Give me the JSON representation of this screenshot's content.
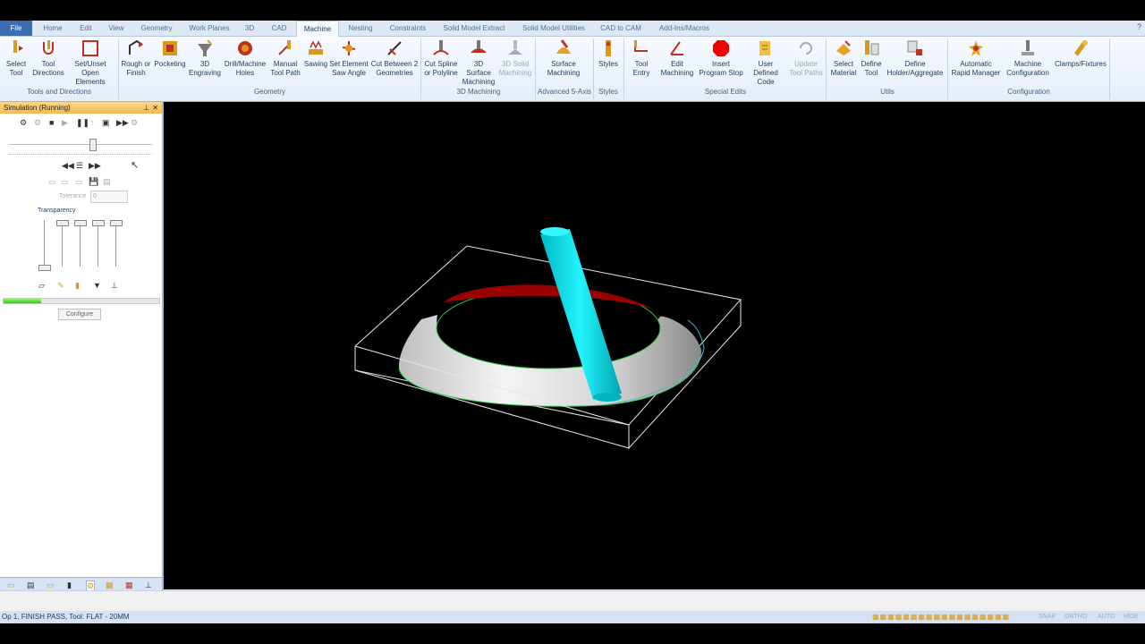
{
  "tabs": [
    {
      "label": "File"
    },
    {
      "label": "Home"
    },
    {
      "label": "Edit"
    },
    {
      "label": "View"
    },
    {
      "label": "Geometry"
    },
    {
      "label": "Work Planes"
    },
    {
      "label": "3D"
    },
    {
      "label": "CAD"
    },
    {
      "label": "Machine"
    },
    {
      "label": "Nesting"
    },
    {
      "label": "Constraints"
    },
    {
      "label": "Solid Model Extract"
    },
    {
      "label": "Solid Model Utilities"
    },
    {
      "label": "CAD to CAM"
    },
    {
      "label": "Add-Ins/Macros"
    }
  ],
  "window_controls": "– ▭ ✕",
  "ribbon": {
    "buttons": [
      {
        "label": "Select Tool",
        "icon": "select-tool-icon"
      },
      {
        "label": "Tool Directions",
        "icon": "tool-directions-icon"
      },
      {
        "label": "Set/Unset Open Elements",
        "icon": "open-elements-icon"
      },
      {
        "label": "Rough or Finish",
        "icon": "rough-finish-icon"
      },
      {
        "label": "Pocketing",
        "icon": "pocketing-icon"
      },
      {
        "label": "3D Engraving",
        "icon": "engraving-icon"
      },
      {
        "label": "Drill/Machine Holes",
        "icon": "drill-icon"
      },
      {
        "label": "Manual Tool Path",
        "icon": "manual-path-icon"
      },
      {
        "label": "Sawing",
        "icon": "sawing-icon"
      },
      {
        "label": "Set Element Saw Angle",
        "icon": "saw-angle-icon"
      },
      {
        "label": "Cut Between 2 Geometries",
        "icon": "cut-between-icon"
      },
      {
        "label": "Cut Spline or Polyline",
        "icon": "cut-spline-icon"
      },
      {
        "label": "3D Surface Machining",
        "icon": "surface-machining-icon"
      },
      {
        "label": "3D Solid Machining",
        "icon": "solid-machining-icon"
      },
      {
        "label": "Surface Machining",
        "icon": "surface-5axis-icon"
      },
      {
        "label": "Styles",
        "icon": "styles-icon"
      },
      {
        "label": "Tool Entry",
        "icon": "tool-entry-icon"
      },
      {
        "label": "Edit Machining",
        "icon": "edit-machining-icon"
      },
      {
        "label": "Insert Program Stop",
        "icon": "program-stop-icon"
      },
      {
        "label": "User Defined Code",
        "icon": "user-code-icon"
      },
      {
        "label": "Update Tool Paths",
        "icon": "update-paths-icon"
      },
      {
        "label": "Select Material",
        "icon": "select-material-icon"
      },
      {
        "label": "Define Tool",
        "icon": "define-tool-icon"
      },
      {
        "label": "Define Holder/Aggregate",
        "icon": "holder-icon"
      },
      {
        "label": "Automatic Rapid Manager",
        "icon": "rapid-manager-icon"
      },
      {
        "label": "Machine Configuration",
        "icon": "machine-config-icon"
      },
      {
        "label": "Clamps/Fixtures",
        "icon": "clamps-icon"
      }
    ],
    "groups": [
      {
        "label": "Tools and Directions"
      },
      {
        "label": "Geometry"
      },
      {
        "label": "3D Machining"
      },
      {
        "label": "Advanced 5-Axis"
      },
      {
        "label": "Styles"
      },
      {
        "label": "Special Edits"
      },
      {
        "label": "Utils"
      },
      {
        "label": "Configuration"
      }
    ]
  },
  "panel": {
    "title": "Simulation (Running)",
    "tolerance_label": "Tolerance",
    "tolerance_value": "0",
    "transparency_label": "Transparency",
    "configure_label": "Configure",
    "progress": 0.24
  },
  "status": {
    "text": "Op 1, FINISH PASS, Tool: FLAT - 20MM",
    "snap": "SNAP",
    "ortho": "ORTHO",
    "auto": "AUTO",
    "hide": "HIDE"
  },
  "colors": {
    "tool": "#00e5ee",
    "part": "#d8d8d8",
    "inner_wall": "#9b0000",
    "edge_green": "#2ecc40",
    "accent": "#3b6db4"
  }
}
